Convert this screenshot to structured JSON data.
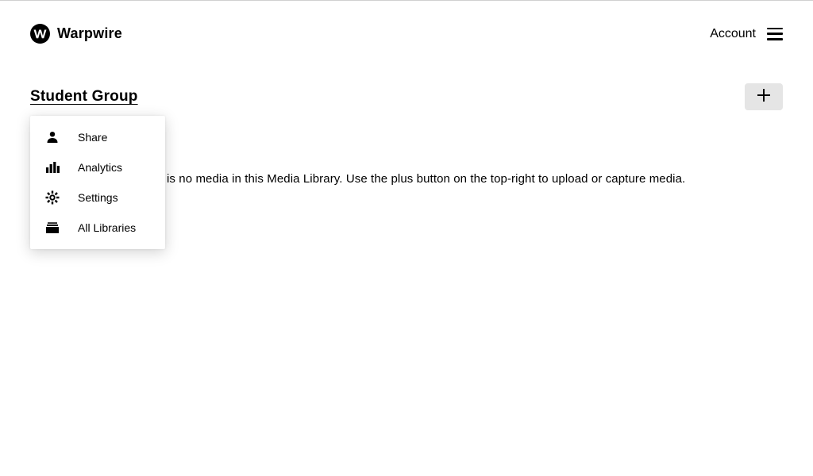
{
  "brand": {
    "name": "Warpwire"
  },
  "header": {
    "account_label": "Account"
  },
  "page": {
    "title": "Student Group"
  },
  "main": {
    "empty_message": "is no media in this Media Library. Use the plus button on the top-right to upload or capture media."
  },
  "dropdown": {
    "items": [
      {
        "icon": "person-icon",
        "label": "Share"
      },
      {
        "icon": "analytics-icon",
        "label": "Analytics"
      },
      {
        "icon": "gear-icon",
        "label": "Settings"
      },
      {
        "icon": "libraries-icon",
        "label": "All Libraries"
      }
    ]
  }
}
